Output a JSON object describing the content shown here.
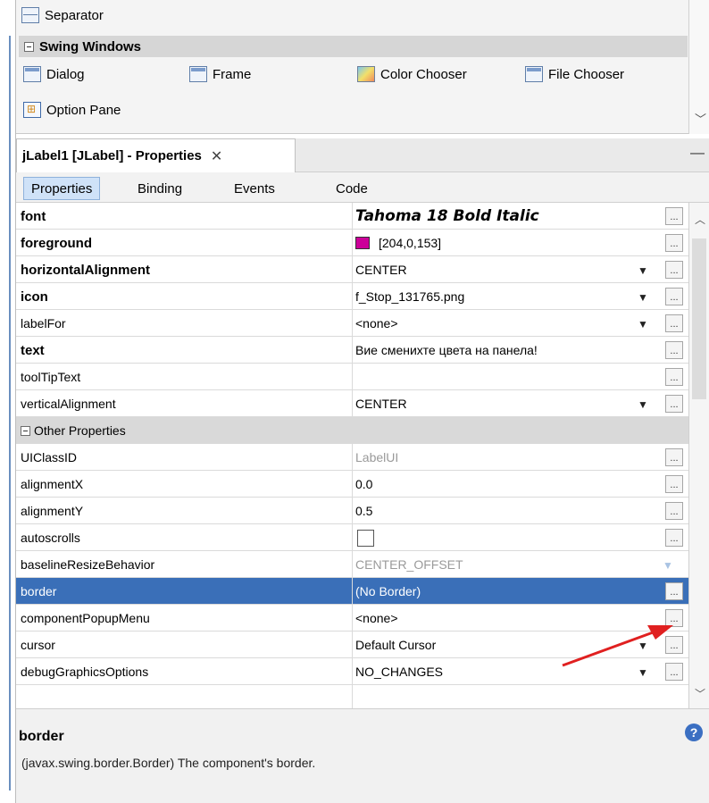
{
  "palette": {
    "separator_label": "Separator",
    "category_label": "Swing Windows",
    "items": [
      "Dialog",
      "Frame",
      "Color Chooser",
      "File Chooser",
      "Option Pane"
    ]
  },
  "properties_window": {
    "tab_title": "jLabel1 [JLabel] - Properties",
    "close_glyph": "✕",
    "minimize_glyph": "—",
    "subtabs": [
      "Properties",
      "Binding",
      "Events",
      "Code"
    ],
    "active_subtab": "Properties",
    "ellipsis": "...",
    "dropdown_glyph": "▼",
    "rows": [
      {
        "name": "font",
        "value": "Tahoma 18 Bold Italic"
      },
      {
        "name": "foreground",
        "value": "[204,0,153]",
        "swatch_color": "#cc0099"
      },
      {
        "name": "horizontalAlignment",
        "value": "CENTER"
      },
      {
        "name": "icon",
        "value": "f_Stop_131765.png"
      },
      {
        "name": "labelFor",
        "value": "<none>"
      },
      {
        "name": "text",
        "value": "Вие сменихте цвета на панела!"
      },
      {
        "name": "toolTipText",
        "value": ""
      },
      {
        "name": "verticalAlignment",
        "value": "CENTER"
      }
    ],
    "group_label": "Other Properties",
    "other_rows": [
      {
        "name": "UIClassID",
        "value": "LabelUI"
      },
      {
        "name": "alignmentX",
        "value": "0.0"
      },
      {
        "name": "alignmentY",
        "value": "0.5"
      },
      {
        "name": "autoscrolls",
        "value": ""
      },
      {
        "name": "baselineResizeBehavior",
        "value": "CENTER_OFFSET"
      },
      {
        "name": "border",
        "value": "(No Border)"
      },
      {
        "name": "componentPopupMenu",
        "value": "<none>"
      },
      {
        "name": "cursor",
        "value": "Default Cursor"
      },
      {
        "name": "debugGraphicsOptions",
        "value": "NO_CHANGES"
      }
    ],
    "selected_row": "border"
  },
  "description": {
    "title": "border",
    "text": "(javax.swing.border.Border) The component's border.",
    "help_glyph": "?"
  },
  "colors": {
    "selection": "#3a6fb8",
    "annotation_arrow": "#e02020"
  }
}
